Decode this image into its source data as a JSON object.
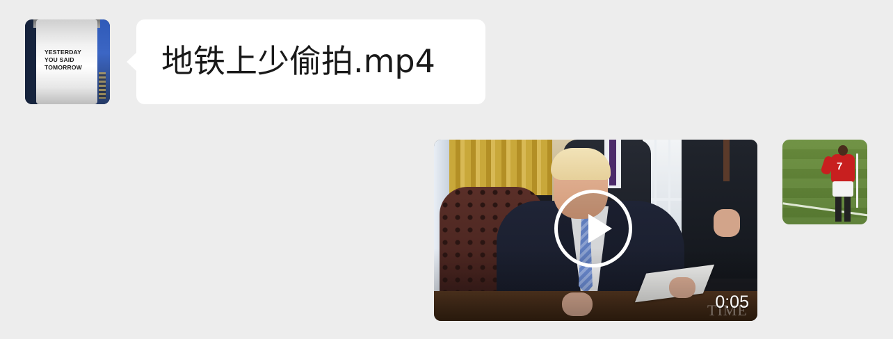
{
  "messages": [
    {
      "direction": "incoming",
      "avatar": {
        "description_icon": "billboard-avatar",
        "text_lines": [
          "YESTERDAY",
          "YOU SAID",
          "TOMORROW"
        ]
      },
      "bubble": {
        "text": "地铁上少偷拍.mp4",
        "background": "#ffffff"
      }
    },
    {
      "direction": "outgoing",
      "video": {
        "duration": "0:05",
        "watermark": "TIME",
        "play_icon": "play-icon"
      },
      "avatar": {
        "description_icon": "soccer-player-avatar",
        "jersey_number": "7"
      }
    }
  ],
  "colors": {
    "background": "#ededed",
    "bubble_incoming": "#ffffff",
    "text": "#191919"
  }
}
